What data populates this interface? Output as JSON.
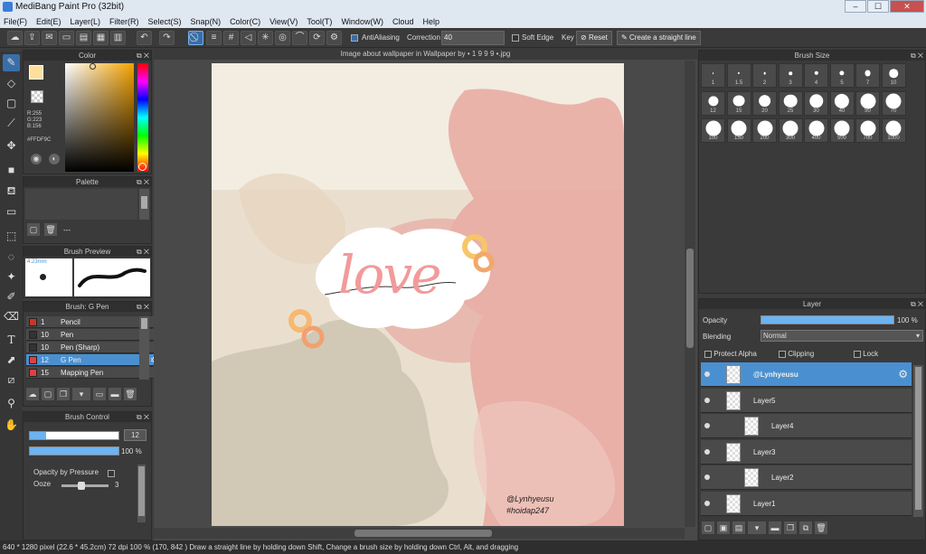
{
  "window": {
    "title": "MediBang Paint Pro (32bit)",
    "min": "–",
    "max": "☐",
    "close": "✕"
  },
  "menu": [
    "File(F)",
    "Edit(E)",
    "Layer(L)",
    "Filter(R)",
    "Select(S)",
    "Snap(N)",
    "Color(C)",
    "View(V)",
    "Tool(T)",
    "Window(W)",
    "Cloud",
    "Help"
  ],
  "toolbar": {
    "antialias_label": "AntiAliasing",
    "correction_label": "Correction",
    "correction_value": "40",
    "softedge_label": "Soft Edge",
    "key_label": "Key",
    "reset_label": "Reset",
    "straight_label": "Create a straight line"
  },
  "color_panel": {
    "title": "Color",
    "r": "R:255",
    "g": "G:223",
    "b": "B:156",
    "hex": "#FFDF9C",
    "current_color": "#FFDF9C"
  },
  "palette_panel": {
    "title": "Palette",
    "dash": "---"
  },
  "brush_preview": {
    "title": "Brush Preview",
    "size": "4.23mm"
  },
  "brush_list": {
    "title": "Brush: G Pen",
    "items": [
      {
        "num": "1",
        "name": "Pencil",
        "color": "#c0392b"
      },
      {
        "num": "10",
        "name": "Pen",
        "color": "#333333"
      },
      {
        "num": "10",
        "name": "Pen (Sharp)",
        "color": "#333333"
      },
      {
        "num": "12",
        "name": "G Pen",
        "color": "#e04040"
      },
      {
        "num": "15",
        "name": "Mapping Pen",
        "color": "#e04040"
      }
    ]
  },
  "brush_control": {
    "title": "Brush Control",
    "size_value": "12",
    "opacity_value": "100 %",
    "size_fraction": 0.18,
    "opacity_fraction": 1.0,
    "opacity_pressure_label": "Opacity by Pressure",
    "ooze_label": "Ooze",
    "ooze_value": "3",
    "ooze_fraction": 0.35
  },
  "canvas": {
    "tab_title": "Image about wallpaper in Wallpaper by • 1 9 9 9 •.jpg",
    "art_text": "love",
    "credit1": "@Lynhyeusu",
    "credit2": "#hoidap247"
  },
  "brush_size": {
    "title": "Brush Size",
    "rows": [
      [
        "1",
        "1.5",
        "2",
        "3",
        "4",
        "5",
        "7",
        "10"
      ],
      [
        "12",
        "15",
        "20",
        "25",
        "30",
        "40",
        "50",
        "70"
      ],
      [
        "100",
        "150",
        "200",
        "300",
        "400",
        "500",
        "700",
        "1000"
      ]
    ]
  },
  "layer_panel": {
    "title": "Layer",
    "opacity_label": "Opacity",
    "opacity_value": "100 %",
    "opacity_fraction": 1.0,
    "blending_label": "Blending",
    "blending_value": "Normal",
    "protect_alpha": "Protect Alpha",
    "clipping": "Clipping",
    "lock": "Lock",
    "layers": [
      {
        "name": "@Lynhyeusu",
        "selected": true
      },
      {
        "name": "Layer5",
        "selected": false
      },
      {
        "name": "Layer4",
        "selected": false
      },
      {
        "name": "Layer3",
        "selected": false
      },
      {
        "name": "Layer2",
        "selected": false
      },
      {
        "name": "Layer1",
        "selected": false
      }
    ]
  },
  "status": "640 * 1280 pixel   (22.6 * 45.2cm)   72 dpi   100 %   (170, 842 )   Draw a straight line by holding down Shift, Change a brush size by holding down Ctrl, Alt, and dragging"
}
